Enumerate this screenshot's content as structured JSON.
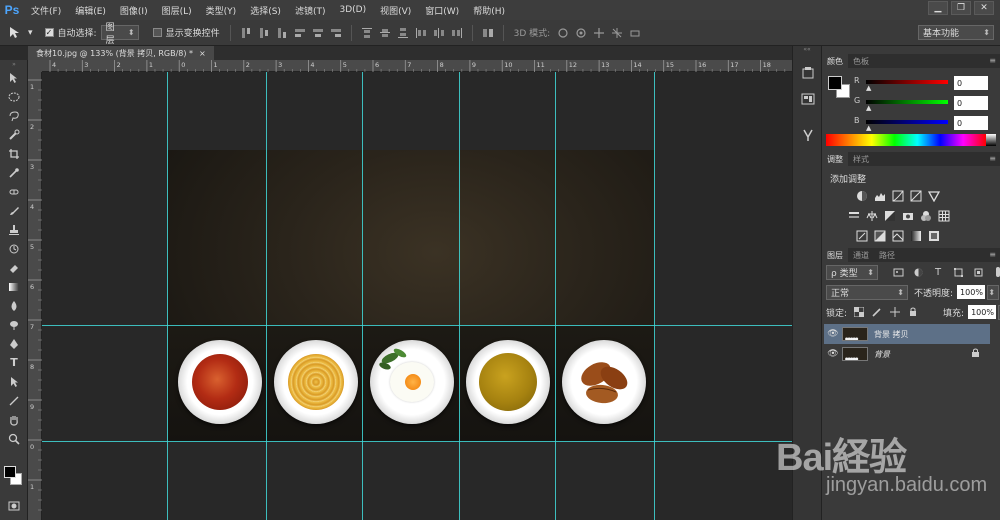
{
  "app": {
    "logo": "Ps"
  },
  "menu": [
    "文件(F)",
    "编辑(E)",
    "图像(I)",
    "图层(L)",
    "类型(Y)",
    "选择(S)",
    "滤镜(T)",
    "3D(D)",
    "视图(V)",
    "窗口(W)",
    "帮助(H)"
  ],
  "window_controls": {
    "minimize": "▁",
    "restore": "❐",
    "close": "✕"
  },
  "options": {
    "auto_select_label": "自动选择:",
    "auto_select_value": "图层",
    "show_transform_label": "显示变换控件",
    "mode_3d_label": "3D 模式:",
    "workspace": "基本功能"
  },
  "document_tab": {
    "title": "食材10.jpg @ 133% (背景 拷贝, RGB/8) *",
    "close": "×"
  },
  "rulers": {
    "top": [
      "4",
      "3",
      "2",
      "1",
      "0",
      "1",
      "2",
      "3",
      "4",
      "5",
      "6",
      "7",
      "8",
      "9",
      "10",
      "11",
      "12",
      "13",
      "14",
      "15",
      "16",
      "17",
      "18"
    ],
    "left": [
      "1",
      "2",
      "3",
      "4",
      "5",
      "6",
      "7",
      "8",
      "9",
      "0",
      "1"
    ]
  },
  "color_panel": {
    "tabs": [
      "颜色",
      "色板"
    ],
    "r_label": "R",
    "g_label": "G",
    "b_label": "B",
    "r_value": "0",
    "g_value": "0",
    "b_value": "0"
  },
  "adjustments_panel": {
    "tabs": [
      "调整",
      "样式"
    ],
    "title": "添加调整"
  },
  "layers_panel": {
    "tabs": [
      "图层",
      "通道",
      "路径"
    ],
    "filter_label": "ρ 类型",
    "blend_mode": "正常",
    "opacity_label": "不透明度:",
    "opacity_value": "100%",
    "lock_label": "锁定:",
    "fill_label": "填充:",
    "fill_value": "100%",
    "layers": [
      {
        "name": "背景 拷贝",
        "selected": true,
        "locked": false
      },
      {
        "name": "背景",
        "selected": false,
        "locked": true
      }
    ]
  },
  "watermark": {
    "brand": "Bai経验",
    "sub": "jingyan.baidu.com"
  }
}
